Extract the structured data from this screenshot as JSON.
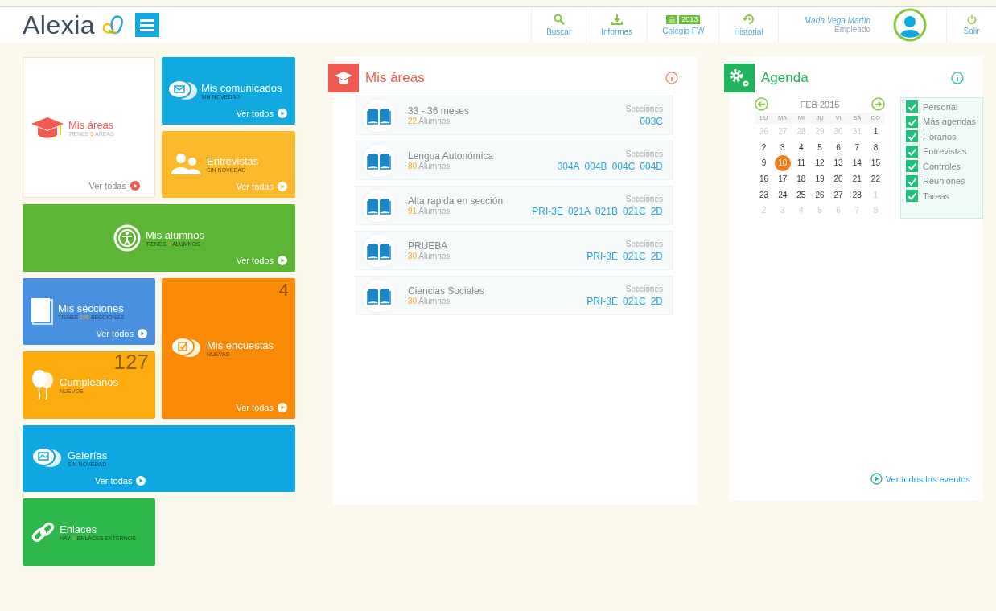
{
  "header": {
    "logo": "Alexia",
    "nav": [
      {
        "kind": "search",
        "label": "Buscar"
      },
      {
        "kind": "download",
        "label": "Informes"
      },
      {
        "kind": "school",
        "label": "Colegio FW",
        "badge": "2013"
      },
      {
        "kind": "history",
        "label": "Historial"
      }
    ],
    "user": {
      "name": "María Vega Martín",
      "role": "Empleado"
    },
    "logout": "Salir"
  },
  "tiles": [
    {
      "kind": "feature",
      "color": "#ffffff",
      "title": "Mis áreas",
      "sub": {
        "prefix": "TIENES",
        "count": "5",
        "suffix": "AREAS"
      },
      "link": "Ver todas"
    },
    {
      "kind": "filled",
      "color": "#12a9e1",
      "title": "Mis comunicados",
      "sub": {
        "prefix": "SIN NOVEDAD"
      },
      "link": "Ver todos"
    },
    {
      "kind": "filled",
      "color": "#fbb92b",
      "title": "Entrevistas",
      "sub": {
        "prefix": "SIN NOVEDAD"
      },
      "link": "Ver todas"
    },
    {
      "kind": "filled",
      "color": "#5cb535",
      "title": "Mis alumnos",
      "sub": {
        "prefix": "TIENES",
        "count": "0",
        "suffix": "ALUMNOS"
      },
      "link": "Ver todos"
    },
    {
      "kind": "filled",
      "color": "#4a90e0",
      "title": "Mis secciones",
      "sub": {
        "prefix": "TIENES",
        "count": "196",
        "suffix": "SECCIONES"
      },
      "link": "Ver todos"
    },
    {
      "kind": "filled",
      "color": "#fb8a06",
      "title": "Mis encuestas",
      "sub": {
        "prefix": "NUEVAS"
      },
      "number": "4",
      "link": "Ver todas"
    },
    {
      "kind": "filled",
      "color": "#fdac0e",
      "title": "Cumpleaños",
      "sub": {
        "prefix": "NUEVOS"
      },
      "number": "127"
    },
    {
      "kind": "filled",
      "color": "#10a8e2",
      "title": "Galerías",
      "sub": {
        "prefix": "SIN NOVEDAD"
      },
      "link": "Ver todas"
    },
    {
      "kind": "filled",
      "color": "#2eb84c",
      "title": "Enlaces",
      "sub": {
        "prefix": "HAY",
        "count": "0",
        "suffix": "ENLACES EXTERNOS"
      }
    }
  ],
  "areas_panel": {
    "title": "Mis áreas",
    "rows": [
      {
        "name": "33 - 36 meses",
        "count": "22",
        "unit": "Alumnos",
        "sections_label": "Secciones",
        "sections": [
          "003C"
        ]
      },
      {
        "name": "Lengua Autonómica",
        "count": "80",
        "unit": "Alumnos",
        "sections_label": "Secciones",
        "sections": [
          "004A",
          "004B",
          "004C",
          "004D"
        ]
      },
      {
        "name": "Alta rapida en sección",
        "count": "91",
        "unit": "Alumnos",
        "sections_label": "Secciones",
        "sections": [
          "PRI-3E",
          "021A",
          "021B",
          "021C",
          "2D"
        ]
      },
      {
        "name": "PRUEBA",
        "count": "30",
        "unit": "Alumnos",
        "sections_label": "Secciones",
        "sections": [
          "PRI-3E",
          "021C",
          "2D"
        ]
      },
      {
        "name": "Ciencias Sociales",
        "count": "30",
        "unit": "Alumnos",
        "sections_label": "Secciones",
        "sections": [
          "PRI-3E",
          "021C",
          "2D"
        ]
      }
    ]
  },
  "agenda": {
    "title": "Agenda",
    "month": "FEB 2015",
    "weekdays": [
      "LU",
      "MA",
      "MI",
      "JU",
      "VI",
      "SÁ",
      "DO"
    ],
    "weeks": [
      [
        {
          "d": "26",
          "outside": true,
          "selected": false
        },
        {
          "d": "27",
          "outside": true,
          "selected": false
        },
        {
          "d": "28",
          "outside": true,
          "selected": false
        },
        {
          "d": "29",
          "outside": true,
          "selected": false
        },
        {
          "d": "30",
          "outside": true,
          "selected": false
        },
        {
          "d": "31",
          "outside": true,
          "selected": false
        },
        {
          "d": "1",
          "outside": false,
          "selected": false
        }
      ],
      [
        {
          "d": "2",
          "outside": false,
          "selected": false
        },
        {
          "d": "3",
          "outside": false,
          "selected": false
        },
        {
          "d": "4",
          "outside": false,
          "selected": false
        },
        {
          "d": "5",
          "outside": false,
          "selected": false
        },
        {
          "d": "6",
          "outside": false,
          "selected": false
        },
        {
          "d": "7",
          "outside": false,
          "selected": false
        },
        {
          "d": "8",
          "outside": false,
          "selected": false
        }
      ],
      [
        {
          "d": "9",
          "outside": false,
          "selected": false
        },
        {
          "d": "10",
          "outside": false,
          "selected": true
        },
        {
          "d": "11",
          "outside": false,
          "selected": false
        },
        {
          "d": "12",
          "outside": false,
          "selected": false
        },
        {
          "d": "13",
          "outside": false,
          "selected": false
        },
        {
          "d": "14",
          "outside": false,
          "selected": false
        },
        {
          "d": "15",
          "outside": false,
          "selected": false
        }
      ],
      [
        {
          "d": "16",
          "outside": false,
          "selected": false
        },
        {
          "d": "17",
          "outside": false,
          "selected": false
        },
        {
          "d": "18",
          "outside": false,
          "selected": false
        },
        {
          "d": "19",
          "outside": false,
          "selected": false
        },
        {
          "d": "20",
          "outside": false,
          "selected": false
        },
        {
          "d": "21",
          "outside": false,
          "selected": false
        },
        {
          "d": "22",
          "outside": false,
          "selected": false
        }
      ],
      [
        {
          "d": "23",
          "outside": false,
          "selected": false
        },
        {
          "d": "24",
          "outside": false,
          "selected": false
        },
        {
          "d": "25",
          "outside": false,
          "selected": false
        },
        {
          "d": "26",
          "outside": false,
          "selected": false
        },
        {
          "d": "27",
          "outside": false,
          "selected": false
        },
        {
          "d": "28",
          "outside": false,
          "selected": false
        },
        {
          "d": "1",
          "outside": true,
          "selected": false
        }
      ],
      [
        {
          "d": "2",
          "outside": true,
          "selected": false
        },
        {
          "d": "3",
          "outside": true,
          "selected": false
        },
        {
          "d": "4",
          "outside": true,
          "selected": false
        },
        {
          "d": "5",
          "outside": true,
          "selected": false
        },
        {
          "d": "6",
          "outside": true,
          "selected": false
        },
        {
          "d": "7",
          "outside": true,
          "selected": false
        },
        {
          "d": "8",
          "outside": true,
          "selected": false
        }
      ]
    ],
    "filters": [
      {
        "label": "Personal",
        "checked": true
      },
      {
        "label": "Más agendas",
        "checked": true
      },
      {
        "label": "Horarios",
        "checked": true
      },
      {
        "label": "Entrevistas",
        "checked": true
      },
      {
        "label": "Controles",
        "checked": true
      },
      {
        "label": "Reuniones",
        "checked": true
      },
      {
        "label": "Tareas",
        "checked": true
      }
    ],
    "all_events": "Ver todos los eventos"
  }
}
